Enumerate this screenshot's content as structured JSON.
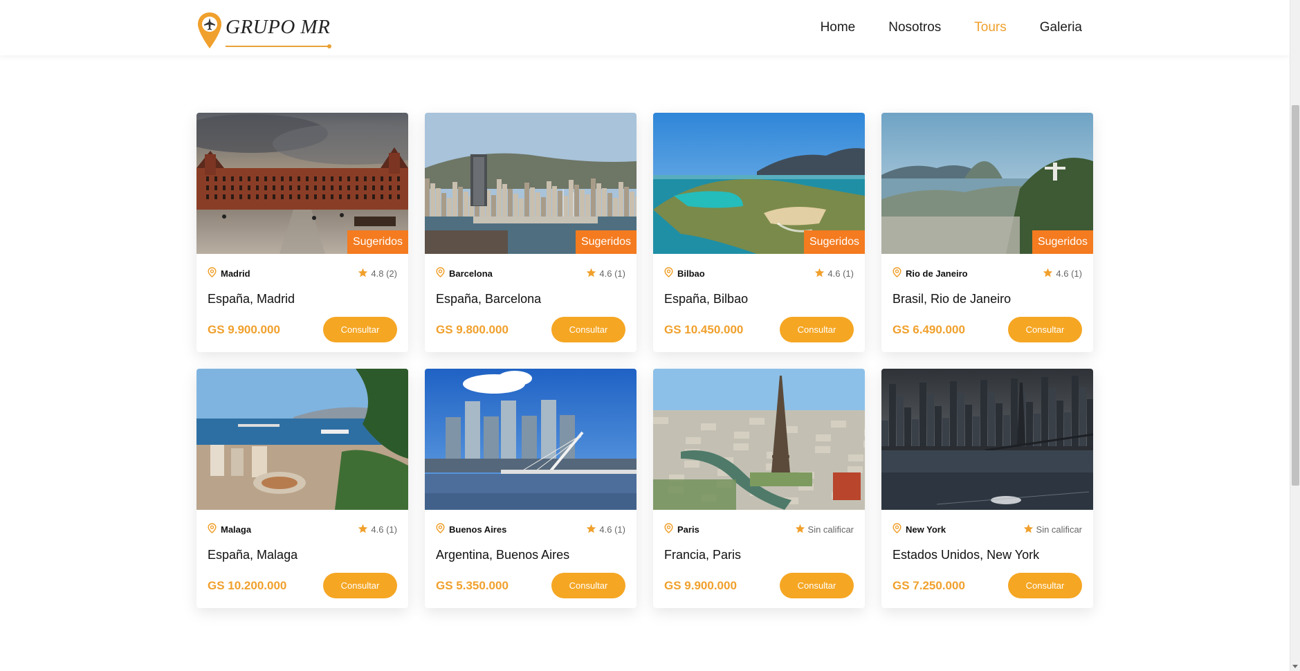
{
  "brand": {
    "name": "GRUPO MR"
  },
  "nav": {
    "items": [
      {
        "label": "Home",
        "active": false
      },
      {
        "label": "Nosotros",
        "active": false
      },
      {
        "label": "Tours",
        "active": true
      },
      {
        "label": "Galeria",
        "active": false
      }
    ]
  },
  "colors": {
    "accent": "#f5a623",
    "badge": "#f47b1f",
    "price": "#f0a02c"
  },
  "button_label": "Consultar",
  "tours": [
    {
      "city": "Madrid",
      "rating": "4.8 (2)",
      "title": "España, Madrid",
      "price": "GS 9.900.000",
      "badge": "Sugeridos",
      "scene": "madrid"
    },
    {
      "city": "Barcelona",
      "rating": "4.6 (1)",
      "title": "España, Barcelona",
      "price": "GS 9.800.000",
      "badge": "Sugeridos",
      "scene": "barcelona"
    },
    {
      "city": "Bilbao",
      "rating": "4.6 (1)",
      "title": "España, Bilbao",
      "price": "GS 10.450.000",
      "badge": "Sugeridos",
      "scene": "bilbao"
    },
    {
      "city": "Rio de Janeiro",
      "rating": "4.6 (1)",
      "title": "Brasil, Rio de Janeiro",
      "price": "GS 6.490.000",
      "badge": "Sugeridos",
      "scene": "rio"
    },
    {
      "city": "Malaga",
      "rating": "4.6 (1)",
      "title": "España, Malaga",
      "price": "GS 10.200.000",
      "badge": "",
      "scene": "malaga"
    },
    {
      "city": "Buenos Aires",
      "rating": "4.6 (1)",
      "title": "Argentina, Buenos Aires",
      "price": "GS 5.350.000",
      "badge": "",
      "scene": "buenosaires"
    },
    {
      "city": "Paris",
      "rating": "Sin calificar",
      "title": "Francia, Paris",
      "price": "GS 9.900.000",
      "badge": "",
      "scene": "paris"
    },
    {
      "city": "New York",
      "rating": "Sin calificar",
      "title": "Estados Unidos, New York",
      "price": "GS 7.250.000",
      "badge": "",
      "scene": "newyork"
    }
  ]
}
